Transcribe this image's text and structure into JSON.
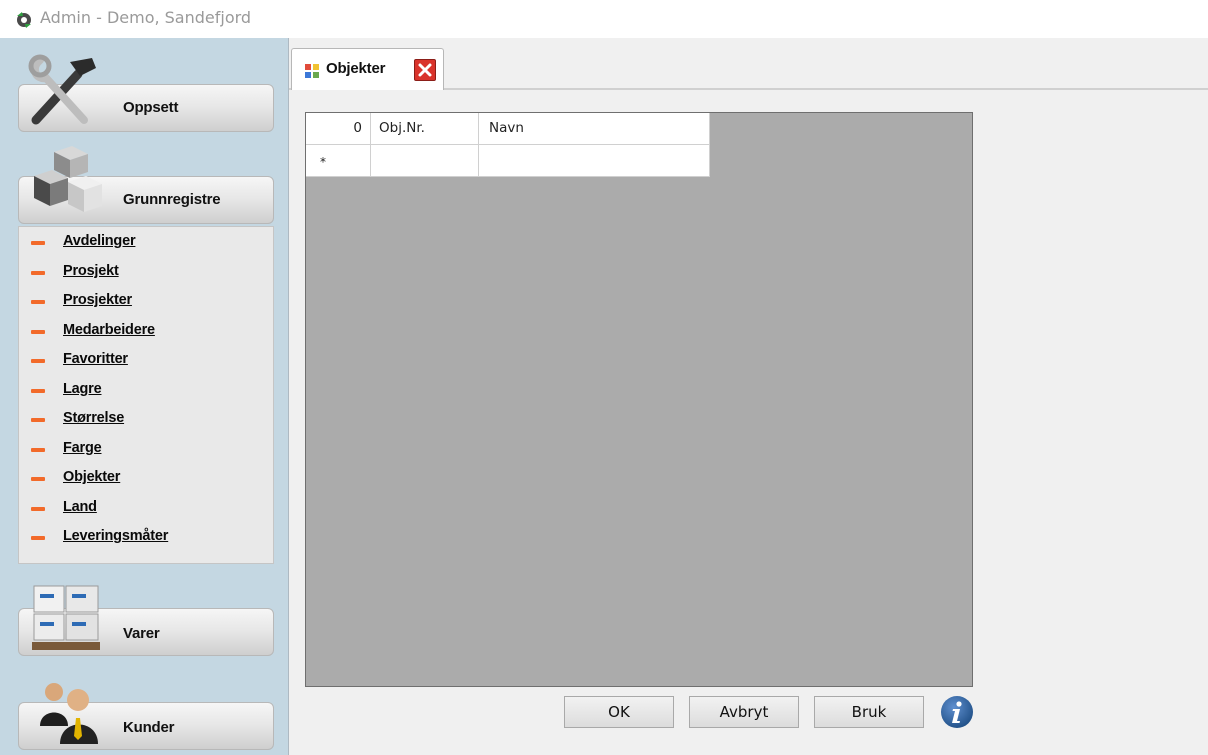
{
  "window": {
    "title": "Admin - Demo, Sandefjord"
  },
  "sidebar": {
    "sections": [
      {
        "label": "Oppsett",
        "icon": "tools-icon"
      },
      {
        "label": "Grunnregistre",
        "icon": "boxes-icon"
      },
      {
        "label": "Varer",
        "icon": "pallet-icon"
      },
      {
        "label": "Kunder",
        "icon": "people-icon"
      }
    ],
    "items": [
      {
        "label": "Avdelinger"
      },
      {
        "label": "Prosjekt"
      },
      {
        "label": "Prosjekter"
      },
      {
        "label": "Medarbeidere"
      },
      {
        "label": "Favoritter"
      },
      {
        "label": "Lagre"
      },
      {
        "label": "Størrelse"
      },
      {
        "label": "Farge"
      },
      {
        "label": "Objekter"
      },
      {
        "label": "Land"
      },
      {
        "label": "Leveringsmåter"
      }
    ]
  },
  "tab": {
    "label": "Objekter"
  },
  "grid": {
    "row_count": "0",
    "columns": [
      "Obj.Nr.",
      "Navn"
    ],
    "new_row_marker": "*"
  },
  "buttons": {
    "ok": "OK",
    "cancel": "Avbryt",
    "apply": "Bruk"
  },
  "colors": {
    "sidebar_bg": "#c4d7e2",
    "bullet": "#f26a2a",
    "grid_bg": "#ababab",
    "close_red": "#d9332b",
    "info_blue": "#1f4f86"
  }
}
